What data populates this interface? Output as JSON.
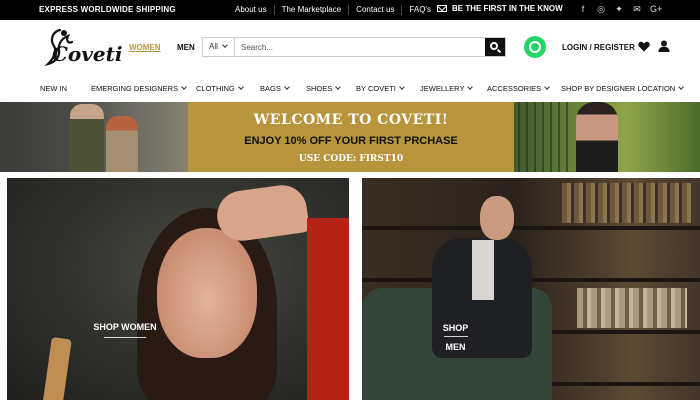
{
  "topbar": {
    "shipping": "EXPRESS WORLDWIDE SHIPPING",
    "links": [
      "About us",
      "The Marketplace",
      "Contact us",
      "FAQ's"
    ],
    "promo": "BE THE FIRST IN THE KNOW",
    "social_icons": [
      "facebook-icon",
      "instagram-icon",
      "twitter-icon",
      "mail-icon",
      "google-plus-icon"
    ]
  },
  "header": {
    "logo": "Coveti",
    "women": "WOMEN",
    "men": "MEN",
    "search": {
      "category": "All",
      "placeholder": "Search..."
    },
    "login": "LOGIN / REGISTER"
  },
  "nav": [
    {
      "label": "NEW IN",
      "dropdown": false
    },
    {
      "label": "EMERGING DESIGNERS",
      "dropdown": true
    },
    {
      "label": "CLOTHING",
      "dropdown": true
    },
    {
      "label": "BAGS",
      "dropdown": true
    },
    {
      "label": "SHOES",
      "dropdown": true
    },
    {
      "label": "BY COVETI",
      "dropdown": true
    },
    {
      "label": "JEWELLERY",
      "dropdown": true
    },
    {
      "label": "ACCESSORIES",
      "dropdown": true
    },
    {
      "label": "SHOP BY DESIGNER LOCATION",
      "dropdown": true
    }
  ],
  "banner": {
    "title": "WELCOME TO COVETI!",
    "offer": "ENJOY 10% OFF YOUR FIRST PRCHASE",
    "code": "USE CODE: FIRST10",
    "background_color": "#b8953c"
  },
  "tiles": {
    "women": "SHOP WOMEN",
    "men_line1": "SHOP",
    "men_line2": "MEN"
  },
  "colors": {
    "accent": "#b8953f",
    "topbar": "#000000",
    "whatsapp": "#25d366"
  }
}
